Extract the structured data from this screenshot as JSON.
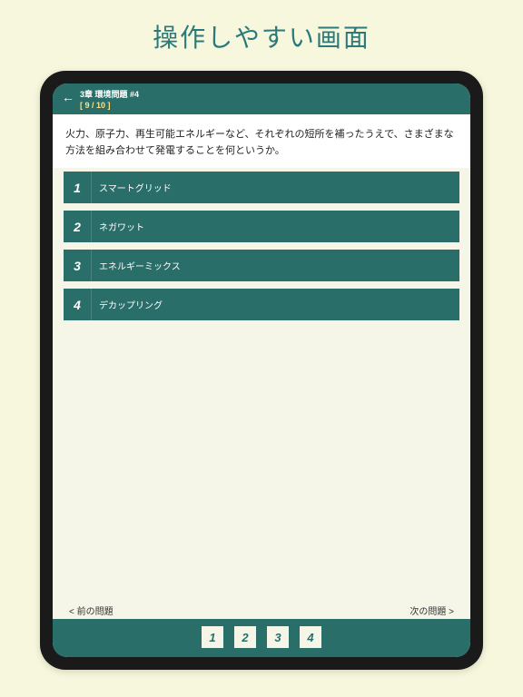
{
  "promo_title": "操作しやすい画面",
  "header": {
    "chapter": "3章 環境問題 #4",
    "counter": "[ 9 / 10 ]"
  },
  "question": "火力、原子力、再生可能エネルギーなど、それぞれの短所を補ったうえで、さまざまな方法を組み合わせて発電することを何というか。",
  "options": [
    {
      "num": "1",
      "label": "スマートグリッド"
    },
    {
      "num": "2",
      "label": "ネガワット"
    },
    {
      "num": "3",
      "label": "エネルギーミックス"
    },
    {
      "num": "4",
      "label": "デカップリング"
    }
  ],
  "nav": {
    "prev": "< 前の問題",
    "next": "次の問題 >"
  },
  "bottom_nums": [
    "1",
    "2",
    "3",
    "4"
  ]
}
